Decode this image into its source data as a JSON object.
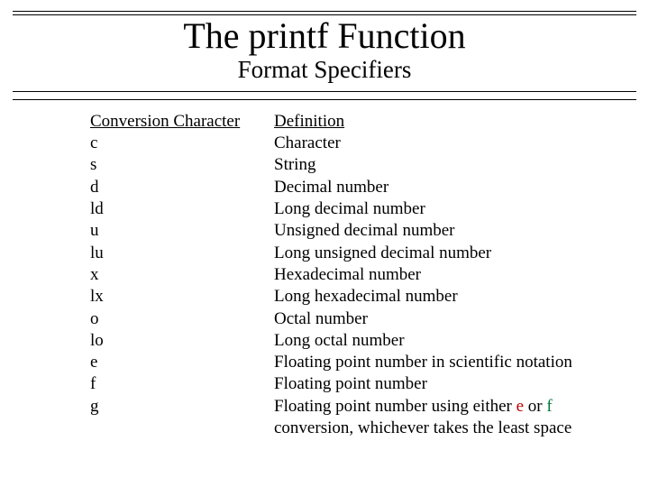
{
  "title": "The printf Function",
  "subtitle": "Format Specifiers",
  "headers": {
    "left": "Conversion Character",
    "right": "Definition"
  },
  "rows": [
    {
      "ch": "c",
      "def": "Character"
    },
    {
      "ch": "s",
      "def": "String"
    },
    {
      "ch": "d",
      "def": "Decimal number"
    },
    {
      "ch": "ld",
      "def": "Long decimal number"
    },
    {
      "ch": "u",
      "def": "Unsigned decimal number"
    },
    {
      "ch": "lu",
      "def": "Long unsigned decimal number"
    },
    {
      "ch": "x",
      "def": "Hexadecimal number"
    },
    {
      "ch": "lx",
      "def": "Long hexadecimal number"
    },
    {
      "ch": "o",
      "def": "Octal number"
    },
    {
      "ch": "lo",
      "def": "Long octal number"
    },
    {
      "ch": "e",
      "def": "Floating point number in scientific notation"
    },
    {
      "ch": "f",
      "def": "Floating point number"
    }
  ],
  "last_row": {
    "ch": "g",
    "def_parts": {
      "p1": "Floating point number using either ",
      "e": "e",
      "p2": " or ",
      "f": "f",
      "p3": " conversion, whichever takes the least space"
    }
  }
}
